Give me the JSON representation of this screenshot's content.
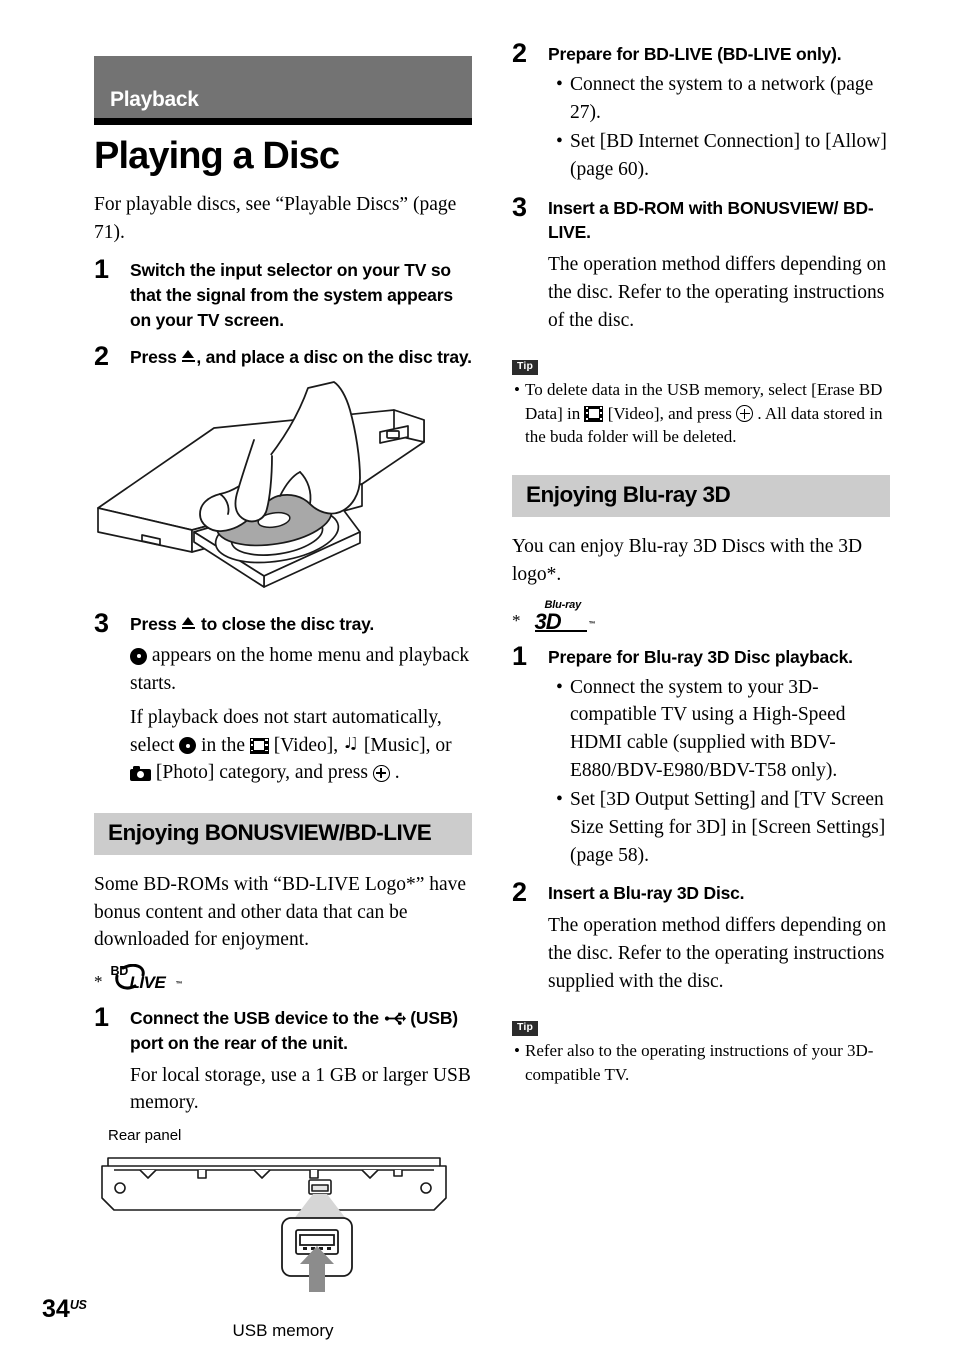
{
  "chapter": {
    "banner_label": "Playback"
  },
  "page_title": "Playing a Disc",
  "intro": "For playable discs, see “Playable Discs” (page 71).",
  "left_column": {
    "steps": [
      {
        "num": "1",
        "head": "Switch the input selector on your TV so that the signal from the system appears on your TV screen."
      },
      {
        "num": "2",
        "head_before_icon": "Press ",
        "head_after_icon": ", and place a disc on the disc tray."
      },
      {
        "num": "3",
        "head_before_icon": "Press ",
        "head_after_icon": " to close the disc tray.",
        "body_1_after_disc": " appears on the home menu and playback starts.",
        "body_2_a": "If playback does not start automatically, select ",
        "body_2_b": " in the ",
        "body_2_c": " [Video], ",
        "body_2_d": " [Music], or ",
        "body_2_e": " [Photo] category, and press ",
        "body_2_f": " ."
      }
    ],
    "tray_figure_alt": "Hand placing a disc on the open disc tray of the unit",
    "section_bonusview": {
      "header": "Enjoying BONUSVIEW/BD-LIVE",
      "intro": "Some BD-ROMs with “BD-LIVE Logo*” have bonus content and other data that can be downloaded for enjoyment.",
      "footnote_star": "*",
      "logo": {
        "bd": "BD",
        "live": "LIVE",
        "tm": "™"
      },
      "steps": [
        {
          "num": "1",
          "head_a": "Connect the USB device to the ",
          "head_b": " (USB) port on the rear of the unit.",
          "body": "For local storage, use a 1 GB or larger USB memory.",
          "figure_caption": "Rear panel",
          "figure_label": "USB memory"
        }
      ]
    }
  },
  "right_column": {
    "steps_bonusview": [
      {
        "num": "2",
        "head": "Prepare for BD-LIVE (BD-LIVE only).",
        "bullets": [
          "Connect the system to a network (page 27).",
          "Set [BD Internet Connection] to [Allow] (page 60)."
        ]
      },
      {
        "num": "3",
        "head": "Insert a BD-ROM with BONUSVIEW/ BD-LIVE.",
        "body": "The operation method differs depending on the disc. Refer to the operating instructions of the disc."
      }
    ],
    "tip_1": {
      "badge": "Tip",
      "text_a": "To delete data in the USB memory, select [Erase BD Data] in ",
      "text_b": " [Video], and press ",
      "text_c": " . All data stored in the buda folder will be deleted."
    },
    "section_bluray3d": {
      "header": "Enjoying Blu-ray 3D",
      "intro": "You can enjoy Blu-ray 3D Discs with the 3D logo*.",
      "footnote_star": "*",
      "logo": {
        "bluray": "Blu-ray",
        "threed": "3D",
        "tm": "™"
      },
      "steps": [
        {
          "num": "1",
          "head": "Prepare for Blu-ray 3D Disc playback.",
          "bullets": [
            "Connect the system to your 3D-compatible TV using a High-Speed HDMI cable (supplied with BDV-E880/BDV-E980/BDV-T58 only).",
            "Set [3D Output Setting] and [TV Screen Size Setting for 3D] in [Screen Settings] (page 58)."
          ]
        },
        {
          "num": "2",
          "head": "Insert a Blu-ray 3D Disc.",
          "body": "The operation method differs depending on the disc. Refer to the operating instructions supplied with the disc."
        }
      ]
    },
    "tip_2": {
      "badge": "Tip",
      "text": "Refer also to the operating instructions of your 3D-compatible TV."
    }
  },
  "footer": {
    "page_number": "34",
    "region": "US"
  },
  "colors": {
    "chapter_banner_bg": "#737373",
    "chapter_banner_text": "#ffffff",
    "section_header_bg": "#cccccc",
    "tip_badge_bg": "#2b2b2b",
    "text": "#000000",
    "figure_gray": "#a8a8a8",
    "arrow_gray": "#8c8c8c"
  }
}
